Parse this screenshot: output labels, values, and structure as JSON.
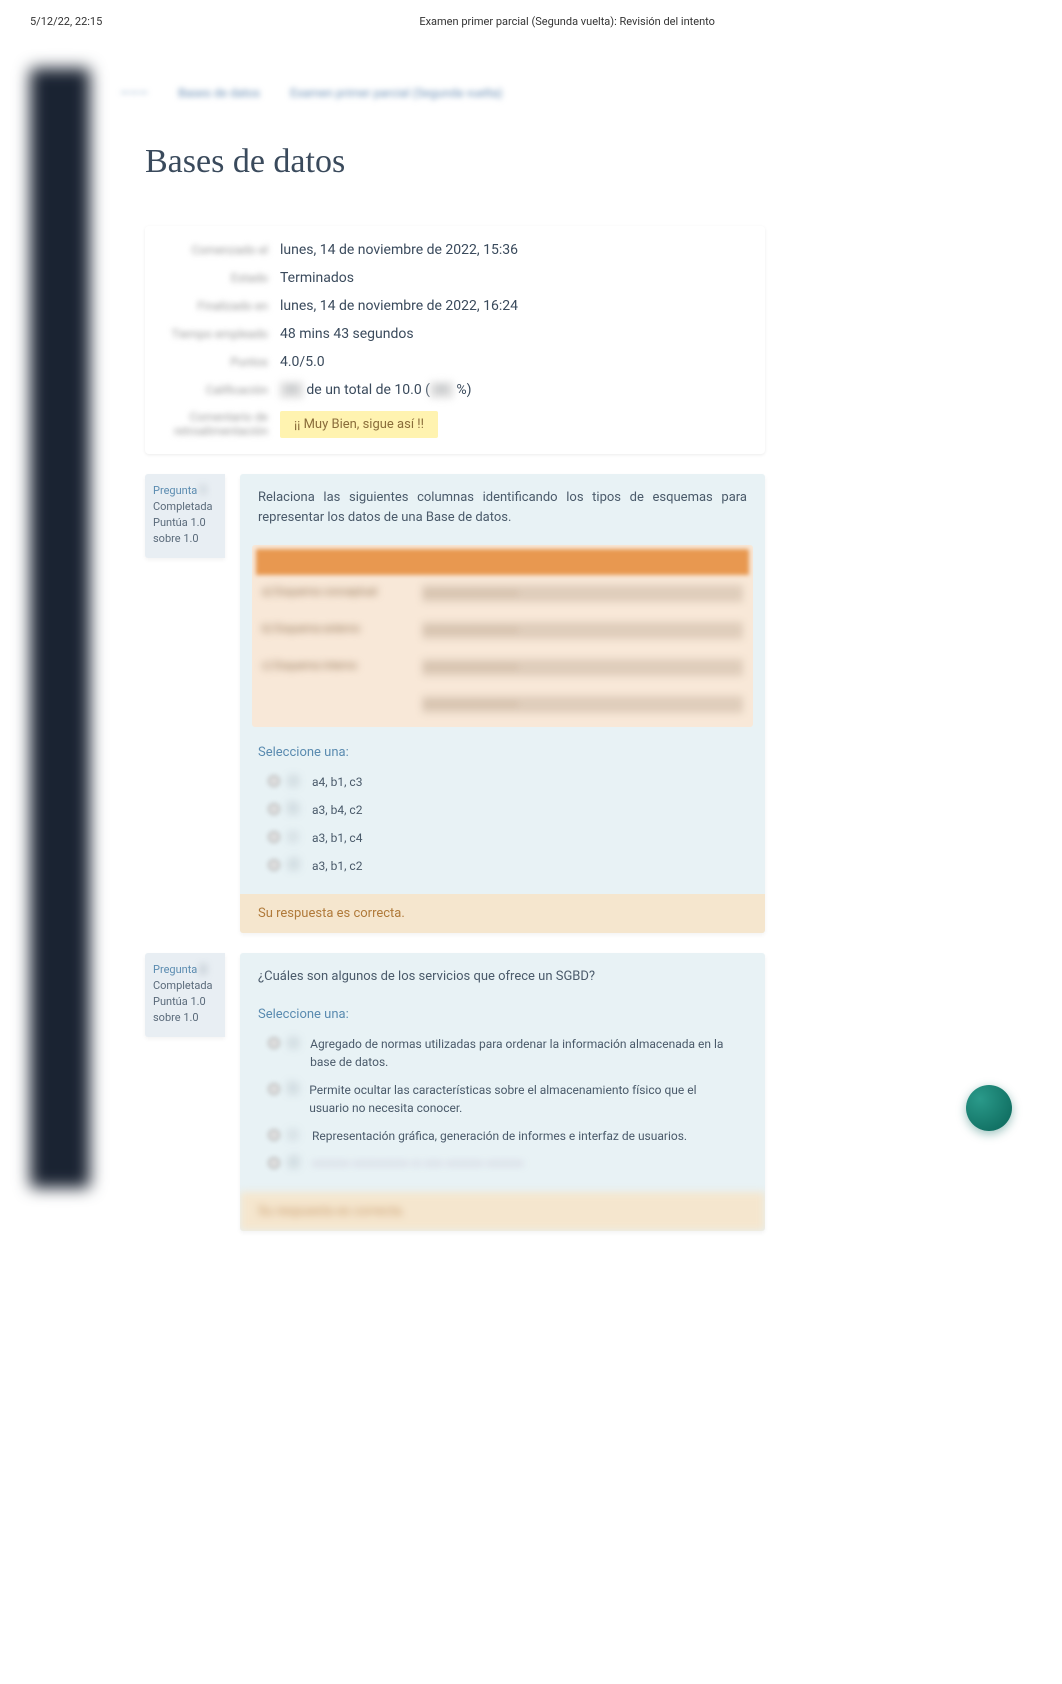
{
  "header": {
    "datetime": "5/12/22, 22:15",
    "title": "Examen primer parcial (Segunda vuelta): Revisión del intento"
  },
  "breadcrumb": {
    "item1": "———",
    "item2": "Bases de datos",
    "item3": "Examen primer parcial (Segunda vuelta)"
  },
  "page_title": "Bases de datos",
  "summary": {
    "row1_label": "Comenzado el",
    "row1_value": "lunes, 14 de noviembre de 2022, 15:36",
    "row2_label": "Estado",
    "row2_value": "Terminados",
    "row3_label": "Finalizado en",
    "row3_value": "lunes, 14 de noviembre de 2022, 16:24",
    "row4_label": "Tiempo empleado",
    "row4_value": "48 mins 43 segundos",
    "row5_label": "Puntos",
    "row5_value": "4.0/5.0",
    "row6_label": "Calificación",
    "row6_prefix": "—",
    "row6_mid": " de un total de 10.0 (",
    "row6_pct": "—",
    "row6_suffix": " %)",
    "row7_label": "Comentario de retroalimentación",
    "row7_value": "¡¡ Muy Bien, sigue así !!"
  },
  "q1": {
    "label": "Pregunta",
    "num": "1",
    "status": "Completada",
    "score_line1": "Puntúa 1.0",
    "score_line2": "sobre 1.0",
    "text": "Relaciona las siguientes columnas identificando los tipos de esquemas para representar los datos de una Base de datos.",
    "matching": {
      "r1_left": "a) Esquema conceptual",
      "r1_right": "———————————",
      "r2_left": "b) Esquema externo",
      "r2_right": "———————————",
      "r3_left": "c) Esquema interno",
      "r3_right": "———————————",
      "r4_left": "",
      "r4_right": "———————————"
    },
    "select_one": "Seleccione una:",
    "options": {
      "a": "a4, b1, c3",
      "b": "a3, b4, c2",
      "c": "a3, b1, c4",
      "d": "a3, b1, c2"
    },
    "feedback": "Su respuesta es correcta."
  },
  "q2": {
    "label": "Pregunta",
    "num": "2",
    "status": "Completada",
    "score_line1": "Puntúa 1.0",
    "score_line2": "sobre 1.0",
    "text": "¿Cuáles son algunos de los servicios que ofrece un SGBD?",
    "select_one": "Seleccione una:",
    "options": {
      "a": "Agregado de normas utilizadas para ordenar la información almacenada en la base de datos.",
      "b": "Permite ocultar las características sobre el almacenamiento físico que el usuario no necesita conocer.",
      "c": "Representación gráfica, generación de informes e interfaz de usuarios.",
      "d": "———— —————— — —— ———— ————"
    },
    "feedback": "Su respuesta es correcta."
  },
  "chat": {
    "name": "chat-widget"
  }
}
